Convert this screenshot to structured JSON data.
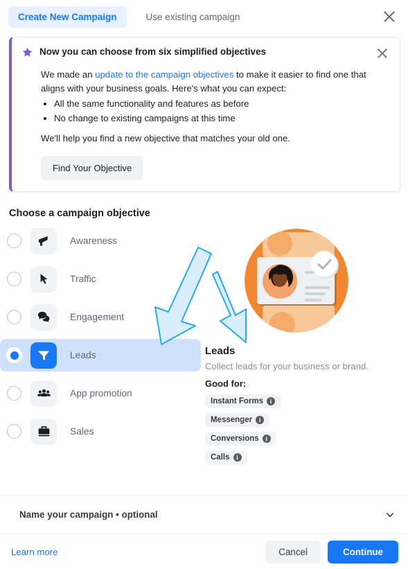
{
  "tabs": {
    "create_label": "Create New Campaign",
    "existing_label": "Use existing campaign",
    "close_icon": "close-icon"
  },
  "notice": {
    "title": "Now you can choose from six simplified objectives",
    "star_icon": "star-icon",
    "close_icon": "close-icon",
    "paragraph_prefix": "We made an ",
    "link_text": "update to the campaign objectives",
    "paragraph_suffix": " to make it easier to find one that aligns with your business goals. Here's what you can expect:",
    "bullets": [
      "All the same functionality and features as before",
      "No change to existing campaigns at this time"
    ],
    "closing": "We'll help you find a new objective that matches your old one.",
    "button_label": "Find Your Objective",
    "accent_color": "#7c5ccf"
  },
  "objectives": {
    "heading": "Choose a campaign objective",
    "items": [
      {
        "label": "Awareness",
        "icon": "megaphone-icon",
        "selected": false
      },
      {
        "label": "Traffic",
        "icon": "cursor-icon",
        "selected": false
      },
      {
        "label": "Engagement",
        "icon": "chat-bubbles-icon",
        "selected": false
      },
      {
        "label": "Leads",
        "icon": "funnel-icon",
        "selected": true
      },
      {
        "label": "App promotion",
        "icon": "people-icon",
        "selected": false
      },
      {
        "label": "Sales",
        "icon": "briefcase-icon",
        "selected": false
      }
    ],
    "selected_color": "#1877f2",
    "selected_row_bg": "#cfe0fd"
  },
  "detail": {
    "illustration_icon": "lead-card-illustration",
    "title": "Leads",
    "description": "Collect leads for your business or brand.",
    "good_for_label": "Good for:",
    "chips": [
      "Instant Forms",
      "Messenger",
      "Conversions",
      "Calls"
    ]
  },
  "annotations": {
    "arrow_color": "#29a8f0",
    "arrow_fill": "#d8eefc",
    "arrow_count": 2
  },
  "name_section": {
    "label": "Name your campaign • optional",
    "chevron_icon": "chevron-down-icon"
  },
  "footer": {
    "learn_more": "Learn more",
    "cancel_label": "Cancel",
    "continue_label": "Continue",
    "primary_color": "#1877f2"
  }
}
